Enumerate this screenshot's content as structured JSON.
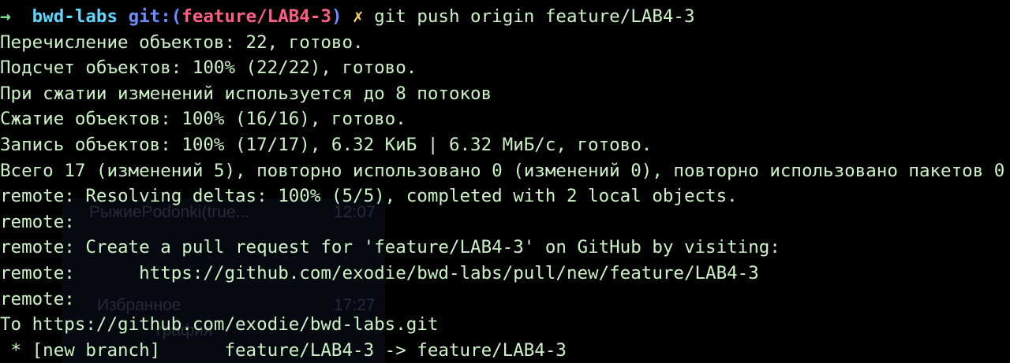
{
  "prompt": {
    "arrow": "→",
    "repo": "bwd-labs",
    "git_open": "git:(",
    "branch": "feature/LAB4-3",
    "git_close": ")",
    "dirty_marker": "✗",
    "command": "git push origin feature/LAB4-3"
  },
  "output": [
    "Перечисление объектов: 22, готово.",
    "Подсчет объектов: 100% (22/22), готово.",
    "При сжатии изменений используется до 8 потоков",
    "Сжатие объектов: 100% (16/16), готово.",
    "Запись объектов: 100% (17/17), 6.32 КиБ | 6.32 МиБ/с, готово.",
    "Всего 17 (изменений 5), повторно использовано 0 (изменений 0), повторно использовано пакетов 0",
    "remote: Resolving deltas: 100% (5/5), completed with 2 local objects.",
    "remote:",
    "remote: Create a pull request for 'feature/LAB4-3' on GitHub by visiting:",
    "remote:      https://github.com/exodie/bwd-labs/pull/new/feature/LAB4-3",
    "remote:",
    "To https://github.com/exodie/bwd-labs.git",
    " * [new branch]      feature/LAB4-3 -> feature/LAB4-3"
  ],
  "background_window": {
    "item1_name": "РыжиеPodonki(true...",
    "item1_time": "12:07",
    "item2_name": "Избранное",
    "item2_time": "17:27",
    "item3_name": "графия"
  },
  "colors": {
    "background": "#000000",
    "text": "#ccf3c6",
    "repo": "#5fd7ff",
    "branch": "#ff5f87",
    "dirty": "#ffd75f"
  }
}
